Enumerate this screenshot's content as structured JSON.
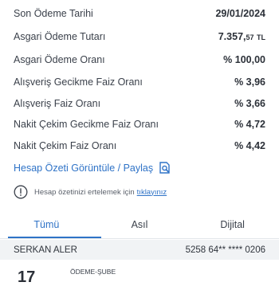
{
  "summary": {
    "rows": [
      {
        "label": "Son Ödeme Tarihi",
        "value": "29/01/2024"
      },
      {
        "label": "Asgari Ödeme Tutarı",
        "value_main": "7.357,",
        "value_cents": "57",
        "value_currency": "TL"
      },
      {
        "label": "Asgari Ödeme Oranı",
        "value": "% 100,00"
      },
      {
        "label": "Alışveriş Gecikme Faiz Oranı",
        "value": "% 3,96"
      },
      {
        "label": "Alışveriş Faiz Oranı",
        "value": "% 3,66"
      },
      {
        "label": "Nakit Çekim Gecikme Faiz Oranı",
        "value": "% 4,72"
      },
      {
        "label": "Nakit Çekim Faiz Oranı",
        "value": "% 4,42"
      }
    ]
  },
  "actions": {
    "view_share_label": "Hesap Özeti Görüntüle / Paylaş",
    "view_share_icon": "document-search-icon"
  },
  "info": {
    "text": "Hesap özetinizi ertelemek için",
    "link": "tıklayınız",
    "icon": "info-circle-icon"
  },
  "tabs": [
    {
      "label": "Tümü",
      "active": true
    },
    {
      "label": "Asıl",
      "active": false
    },
    {
      "label": "Dijital",
      "active": false
    }
  ],
  "card": {
    "holder_name": "SERKAN ALER",
    "number": "5258 64** **** 0206"
  },
  "transaction": {
    "day": "17",
    "description": "ÖDEME-ŞUBE"
  },
  "colors": {
    "accent": "#2f73c7",
    "text": "#333a45",
    "header_bg": "#f1f3f5"
  }
}
